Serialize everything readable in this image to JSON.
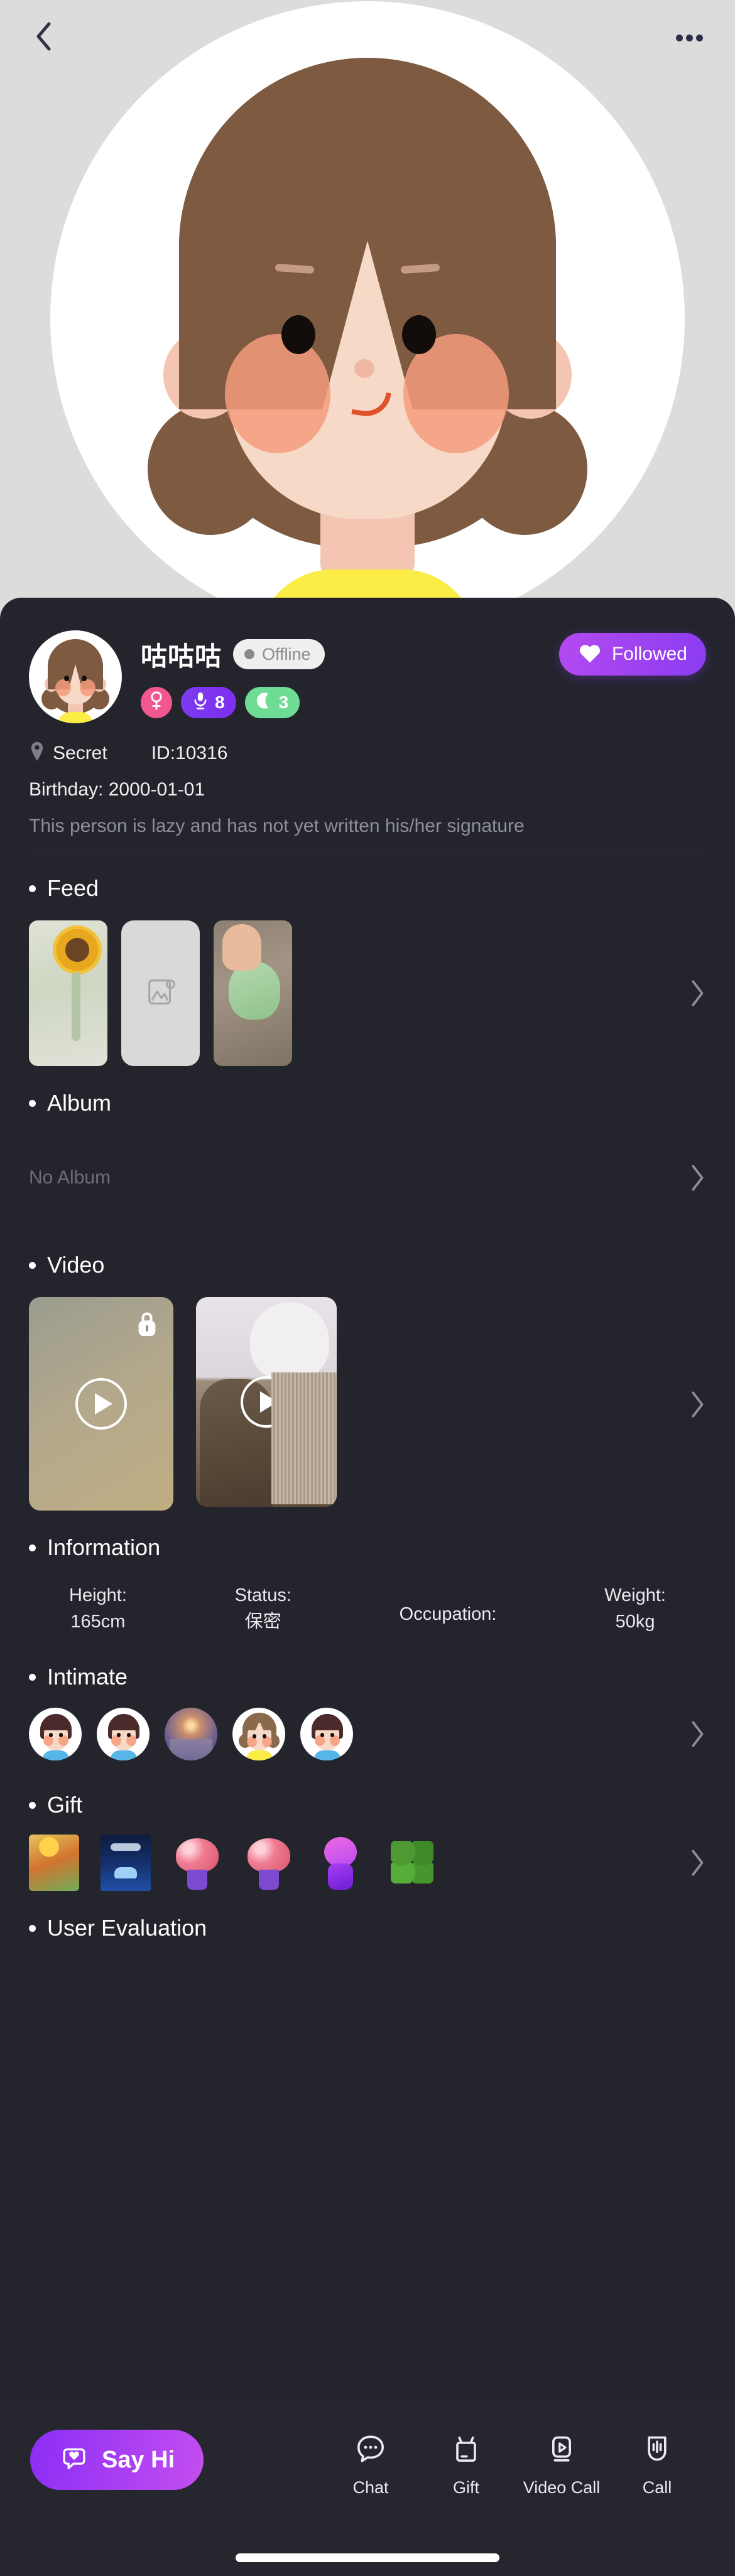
{
  "header": {
    "back_icon": "chevron-left-icon",
    "more_icon": "more-options-icon"
  },
  "profile": {
    "name": "咕咕咕",
    "status_label": "Offline",
    "follow_label": "Followed",
    "follow_icon": "heart-icon",
    "badges": [
      {
        "name": "gender",
        "icon": "female-gender-icon",
        "value": "",
        "color": "#f2588f"
      },
      {
        "name": "voice-level",
        "icon": "microphone-icon",
        "value": "8",
        "color": "#7b3cf0"
      },
      {
        "name": "moon-level",
        "icon": "moon-icon",
        "value": "3",
        "color": "#6fdc96"
      }
    ],
    "location_icon": "location-pin-icon",
    "location": "Secret",
    "id": "ID:10316",
    "birthday": "Birthday: 2000-01-01",
    "signature": "This person is lazy and has not yet written his/her signature"
  },
  "sections": {
    "feed": {
      "title": "Feed",
      "chevron_icon": "chevron-right-icon",
      "items": [
        {
          "kind": "photo",
          "alt": "crochet sunflower bouquet"
        },
        {
          "kind": "placeholder",
          "icon": "image-placeholder-icon"
        },
        {
          "kind": "photo",
          "alt": "hand holding green pu-erh tea cake"
        }
      ]
    },
    "album": {
      "title": "Album",
      "empty_label": "No Album",
      "chevron_icon": "chevron-right-icon"
    },
    "video": {
      "title": "Video",
      "chevron_icon": "chevron-right-icon",
      "items": [
        {
          "locked": true,
          "lock_icon": "lock-icon",
          "play_icon": "play-icon",
          "alt": "blurred locked video"
        },
        {
          "locked": false,
          "play_icon": "play-icon",
          "alt": "two cats on cat tree"
        }
      ]
    },
    "information": {
      "title": "Information",
      "fields": [
        {
          "label": "Height:",
          "value": "165cm"
        },
        {
          "label": "Status:",
          "value": "保密"
        },
        {
          "label": "Occupation:",
          "value": ""
        },
        {
          "label": "Weight:",
          "value": "50kg"
        }
      ]
    },
    "intimate": {
      "title": "Intimate",
      "chevron_icon": "chevron-right-icon",
      "items": [
        {
          "type": "boy-avatar"
        },
        {
          "type": "boy-avatar"
        },
        {
          "type": "photo-avatar"
        },
        {
          "type": "girl-avatar"
        },
        {
          "type": "boy-avatar"
        }
      ]
    },
    "gift": {
      "title": "Gift",
      "chevron_icon": "chevron-right-icon",
      "items": [
        {
          "name": "plane-gift"
        },
        {
          "name": "sports-car-gift"
        },
        {
          "name": "rose-bouquet-gift"
        },
        {
          "name": "rose-bouquet-gift"
        },
        {
          "name": "purple-bear-gift"
        },
        {
          "name": "four-leaf-clover-gift"
        }
      ]
    },
    "user_evaluation": {
      "title": "User Evaluation"
    }
  },
  "bottom_bar": {
    "primary": {
      "label": "Say Hi",
      "icon": "chat-heart-icon"
    },
    "actions": [
      {
        "label": "Chat",
        "icon": "chat-bubble-icon"
      },
      {
        "label": "Gift",
        "icon": "gift-box-icon"
      },
      {
        "label": "Video Call",
        "icon": "video-call-icon"
      },
      {
        "label": "Call",
        "icon": "voice-call-icon"
      }
    ]
  },
  "colors": {
    "background": "#23242c",
    "accent_purple": "#8b3cf2",
    "accent_magenta": "#c44ef0",
    "badge_pink": "#f2588f",
    "badge_green": "#6fdc96",
    "muted_text": "#8e8f96"
  }
}
